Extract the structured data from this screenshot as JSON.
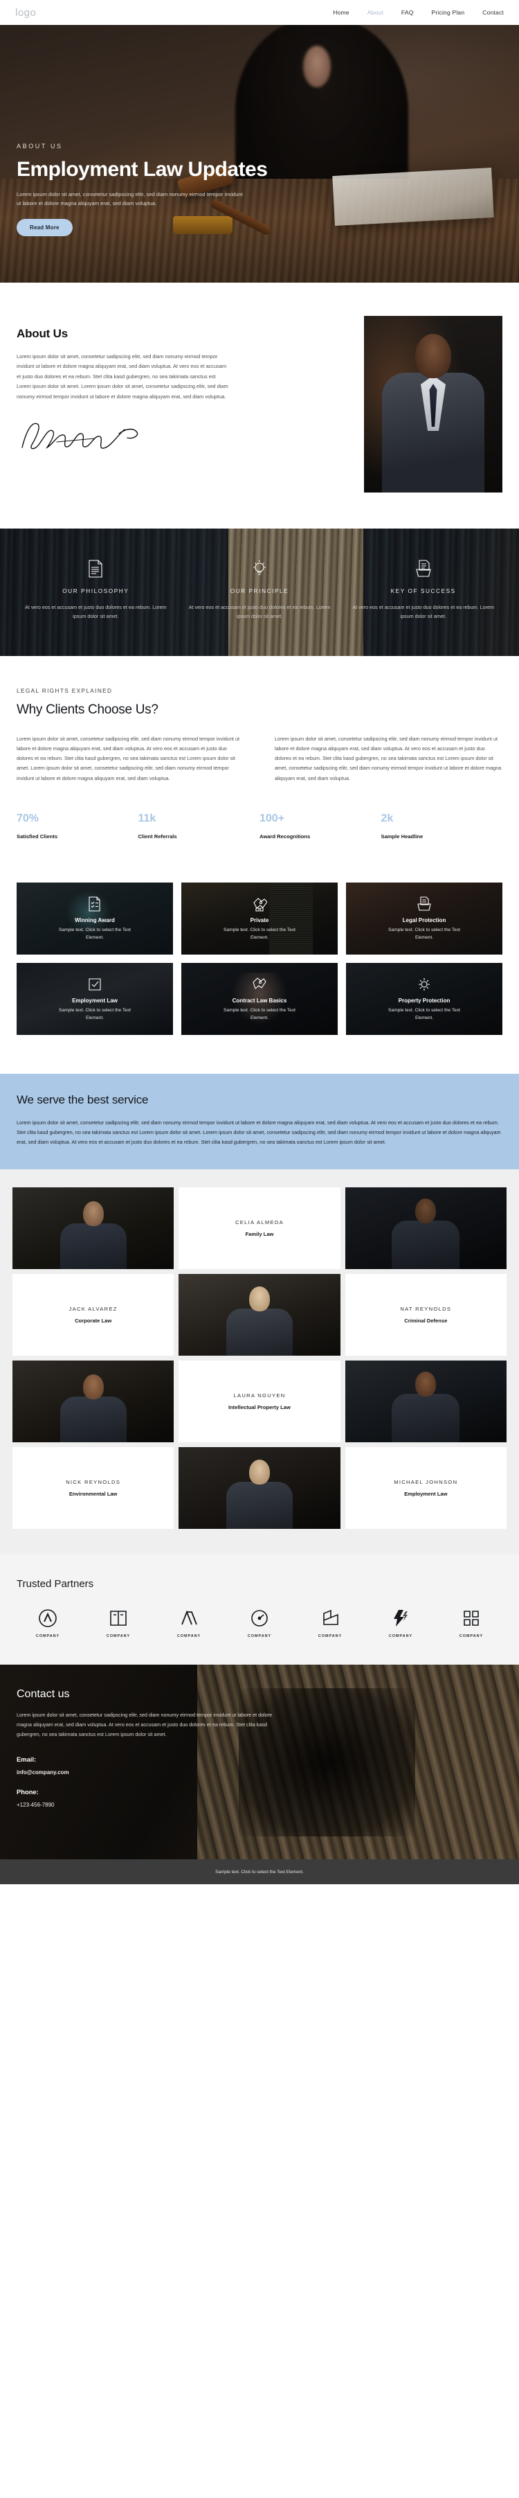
{
  "header": {
    "logo": "logo",
    "nav": [
      {
        "label": "Home",
        "active": false
      },
      {
        "label": "About",
        "active": true
      },
      {
        "label": "FAQ",
        "active": false
      },
      {
        "label": "Pricing Plan",
        "active": false
      },
      {
        "label": "Contact",
        "active": false
      }
    ]
  },
  "hero": {
    "eyebrow": "ABOUT US",
    "title": "Employment Law Updates",
    "description": "Lorem ipsum dolor sit amet, consetetur sadipscing elitr, sed diam nonumy eirmod tempor invidunt ut labore et dolore magna aliquyam erat, sed diam voluptua.",
    "button": "Read More"
  },
  "about": {
    "title": "About Us",
    "paragraph": "Lorem ipsum dolor sit amet, consetetur sadipscing elitr, sed diam nonumy eirmod tempor invidunt ut labore et dolore magna aliquyam erat, sed diam voluptua. At vero eos et accusam et justo duo dolores et ea rebum. Stet clita kasd gubergren, no sea takimata sanctus est Lorem ipsum dolor sit amet. Lorem ipsum dolor sit amet, consetetur sadipscing elitr, sed diam nonumy eirmod tempor invidunt ut labore et dolore magna aliquyam erat, sed diam voluptua.",
    "signature_alt": "handwritten signature"
  },
  "pillars": [
    {
      "icon": "document-lines-icon",
      "title": "OUR PHILOSOPHY",
      "text": "At vero eos et accusam et justo duo dolores et ea rebum. Lorem ipsum dolor sit amet."
    },
    {
      "icon": "lightbulb-icon",
      "title": "OUR PRINCIPLE",
      "text": "At vero eos et accusam et justo duo dolores et ea rebum. Lorem ipsum dolor sit amet."
    },
    {
      "icon": "folder-document-icon",
      "title": "KEY OF SUCCESS",
      "text": "At vero eos et accusam et justo duo dolores et ea rebum. Lorem ipsum dolor sit amet."
    }
  ],
  "why": {
    "eyebrow": "LEGAL RIGHTS EXPLAINED",
    "title": "Why Clients Choose Us?",
    "column_left": "Lorem ipsum dolor sit amet, consetetur sadipscing elitr, sed diam nonumy eirmod tempor invidunt ut labore et dolore magna aliquyam erat, sed diam voluptua. At vero eos et accusam et justo duo dolores et ea rebum. Stet clita kasd gubergren, no sea takimata sanctus est Lorem ipsum dolor sit amet. Lorem ipsum dolor sit amet, consetetur sadipscing elitr, sed diam nonumy eirmod tempor invidunt ut labore et dolore magna aliquyam erat, sed diam voluptua.",
    "column_right": "Lorem ipsum dolor sit amet, consetetur sadipscing elitr, sed diam nonumy eirmod tempor invidunt ut labore et dolore magna aliquyam erat, sed diam voluptua. At vero eos et accusam et justo duo dolores et ea rebum. Stet clita kasd gubergren, no sea takimata sanctus est Lorem ipsum dolor sit amet, consetetur sadipscing elitr, sed diam nonumy eirmod tempor invidunt ut labore et dolore magna aliquyam erat, sed diam voluptua."
  },
  "stats": [
    {
      "value": "70%",
      "label": "Satisfied Clients"
    },
    {
      "value": "11k",
      "label": "Client Referrals"
    },
    {
      "value": "100+",
      "label": "Award Recognitions"
    },
    {
      "value": "2k",
      "label": "Sample Headline"
    }
  ],
  "cards": [
    {
      "icon": "checklist-document-icon",
      "title": "Winning Award",
      "desc": "Sample text. Click to select the Text Element."
    },
    {
      "icon": "handshake-icon",
      "title": "Private",
      "desc": "Sample text. Click to select the Text Element."
    },
    {
      "icon": "folder-document-icon",
      "title": "Legal Protection",
      "desc": "Sample text. Click to select the Text Element."
    },
    {
      "icon": "shield-check-icon",
      "title": "Employment Law",
      "desc": "Sample text. Click to select the Text Element."
    },
    {
      "icon": "handshake-icon",
      "title": "Contract Law Basics",
      "desc": "Sample text. Click to select the Text Element."
    },
    {
      "icon": "gear-icon",
      "title": "Property Protection",
      "desc": "Sample text. Click to select the Text Element."
    }
  ],
  "serve": {
    "title": "We serve the best service",
    "text": "Lorem ipsum dolor sit amet, consetetur sadipscing elitr, sed diam nonumy eirmod tempor invidunt ut labore et dolore magna aliquyam erat, sed diam voluptua. At vero eos et accusam et justo duo dolores et ea rebum. Stet clita kasd gubergren, no sea takimata sanctus est Lorem ipsum dolor sit amet. Lorem ipsum dolor sit amet, consetetur sadipscing elitr, sed diam nonumy eirmod tempor invidunt ut labore et dolore magna aliquyam erat, sed diam voluptua. At vero eos et accusam et justo duo dolores et ea rebum. Stet clita kasd gubergren, no sea takimata sanctus est Lorem ipsum dolor sit amet."
  },
  "team": [
    {
      "name": "CELIA ALMEDA",
      "role": "Family Law"
    },
    {
      "name": "JACK ALVAREZ",
      "role": "Corporate Law"
    },
    {
      "name": "NAT REYNOLDS",
      "role": "Criminal Defense"
    },
    {
      "name": "LAURA NGUYEN",
      "role": "Intellectual Property Law"
    },
    {
      "name": "NICK REYNOLDS",
      "role": "Environmental Law"
    },
    {
      "name": "MICHAEL JOHNSON",
      "role": "Employment Law"
    }
  ],
  "partners": {
    "title": "Trusted Partners",
    "items": [
      {
        "icon": "circle-monogram-icon",
        "name": "COMPANY"
      },
      {
        "icon": "book-icon",
        "name": "COMPANY"
      },
      {
        "icon": "flag-stripes-icon",
        "name": "COMPANY"
      },
      {
        "icon": "speedometer-icon",
        "name": "COMPANY"
      },
      {
        "icon": "origami-icon",
        "name": "COMPANY"
      },
      {
        "icon": "lightning-icon",
        "name": "COMPANY"
      },
      {
        "icon": "pillars-icon",
        "name": "COMPANY"
      }
    ]
  },
  "contact": {
    "title": "Contact us",
    "text": "Lorem ipsum dolor sit amet, consetetur sadipscing elitr, sed diam nonumy eirmod tempor invidunt ut labore et dolore magna aliquyam erat, sed diam voluptua. At vero eos et accusam et justo duo dolores et ea rebum. Stet clita kasd gubergren, no sea takimata sanctus est Lorem ipsum dolor sit amet.",
    "email_label": "Email:",
    "email_value": "info@company.com",
    "phone_label": "Phone:",
    "phone_value": "+123-456-7890"
  },
  "footer": {
    "text": "Sample text. Click to select the Text Element."
  },
  "colors": {
    "accent_blue": "#abc8e6",
    "stat_blue": "#a9c6e4",
    "button_blue": "#b9d2ec",
    "footer_gray": "#3c3c3c",
    "team_bg": "#efefef"
  }
}
